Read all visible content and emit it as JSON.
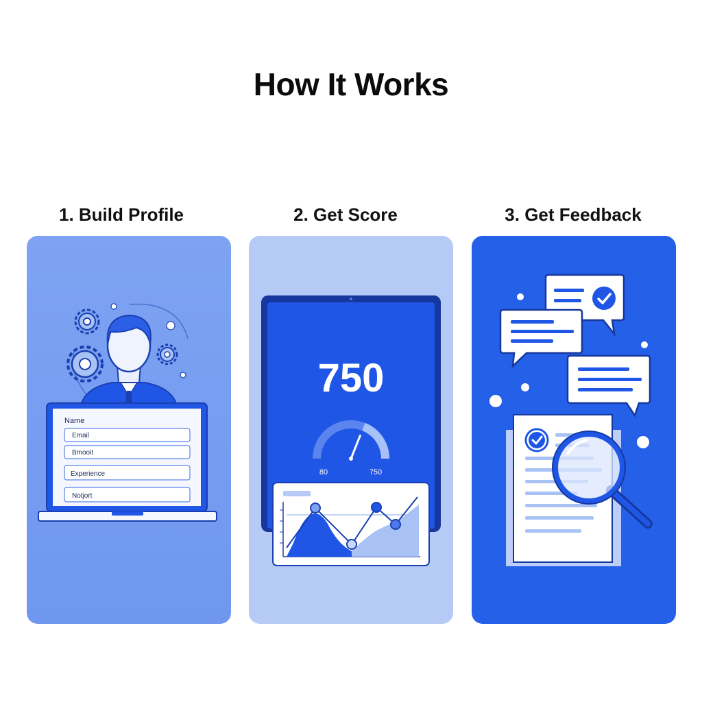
{
  "page": {
    "title": "How It Works"
  },
  "steps": [
    {
      "title": "1. Build Profile",
      "form": {
        "header": "Name",
        "fields": [
          "Email",
          "Bmooit",
          "Experience",
          "Notjort"
        ]
      }
    },
    {
      "title": "2. Get Score",
      "score": {
        "value": "750",
        "gauge_min_label": "80",
        "gauge_max_label": "750",
        "gauge_level": 0.62
      }
    },
    {
      "title": "3. Get Feedback"
    }
  ],
  "colors": {
    "primary": "#1f56e6",
    "card1": "#7ea3f2",
    "card2": "#b5cbf6",
    "card3": "#2460e8",
    "ink": "#1a3fb0"
  },
  "icons": [
    "gear-icon",
    "user-avatar-icon",
    "laptop-icon",
    "tablet-icon",
    "gauge-icon",
    "line-chart-icon",
    "speech-bubble-icon",
    "check-icon",
    "document-icon",
    "magnifier-icon"
  ]
}
